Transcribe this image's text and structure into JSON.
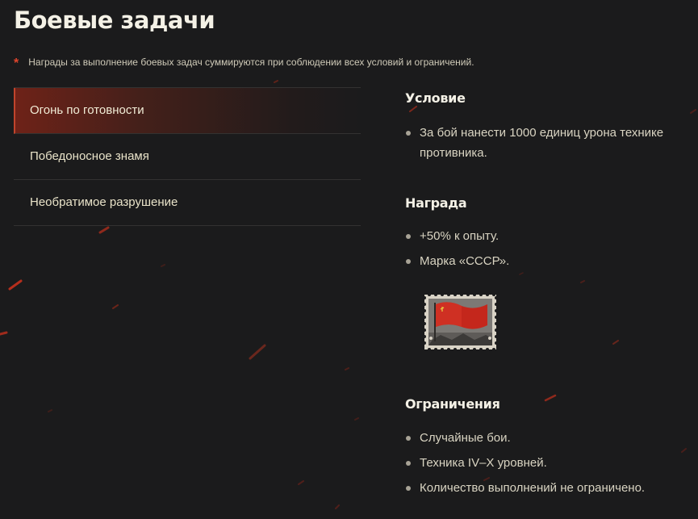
{
  "page": {
    "title": "Боевые задачи",
    "note_marker": "*",
    "note": "Награды за выполнение боевых задач суммируются при соблюдении всех условий и ограничений."
  },
  "tabs": [
    {
      "label": "Огонь по готовности",
      "active": true
    },
    {
      "label": "Победоносное знамя",
      "active": false
    },
    {
      "label": "Необратимое разрушение",
      "active": false
    }
  ],
  "details": {
    "condition": {
      "heading": "Условие",
      "items": [
        "За бой нанести 1000 единиц урона технике противника."
      ]
    },
    "reward": {
      "heading": "Награда",
      "items": [
        "+50% к опыту.",
        "Марка «СССР»."
      ],
      "stamp_icon": "ussr-red-flag-stamp-icon"
    },
    "restrictions": {
      "heading": "Ограничения",
      "items": [
        "Случайные бои.",
        "Техника IV–X уровней.",
        "Количество выполнений не ограничено."
      ]
    }
  },
  "colors": {
    "background": "#1b1b1c",
    "accent": "#c0442c",
    "text": "#e6e1cf"
  }
}
